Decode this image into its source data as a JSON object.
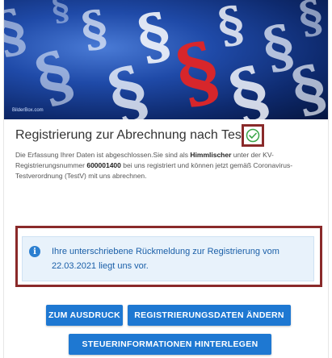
{
  "hero": {
    "credit": "BilderBox.com",
    "alt": "Paragraphen-Symbole"
  },
  "title": "Registrierung zur Abrechnung nach TestV",
  "description": {
    "part1": "Die Erfassung Ihrer Daten ist abgeschlossen.Sie sind als ",
    "strong1": "Himmlischer",
    "part2": " unter der KV-Registrierungsnummer ",
    "strong2": "600001400",
    "part3": " bei uns registriert und können jetzt gemäß Coronavirus-Testverordnung (TestV) mit uns abrechnen."
  },
  "info": {
    "icon": "info-icon",
    "text": "Ihre unterschriebene Rückmeldung zur Registrierung vom 22.03.2021 liegt uns vor."
  },
  "buttons": {
    "print": "ZUM AUSDRUCK",
    "edit": "REGISTRIERUNGSDATEN ÄNDERN",
    "tax": "STEUERINFORMATIONEN HINTERLEGEN"
  },
  "colors": {
    "accent": "#1e78d2",
    "highlight_frame": "#8a2a2a",
    "success": "#3aa548",
    "info_bg": "#e8f2fb"
  }
}
